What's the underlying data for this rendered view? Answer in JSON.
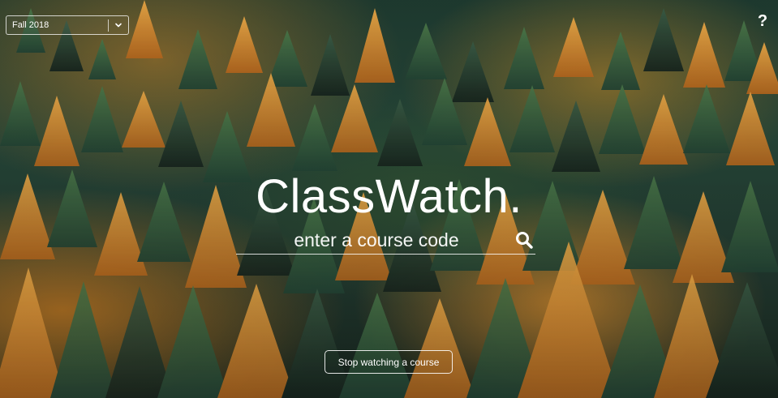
{
  "term_selector": {
    "value": "Fall 2018"
  },
  "help": {
    "label": "?"
  },
  "hero": {
    "brand": "ClassWatch.",
    "search_placeholder": "enter a course code",
    "search_icon": "search-icon"
  },
  "actions": {
    "stop_label": "Stop watching a course"
  }
}
